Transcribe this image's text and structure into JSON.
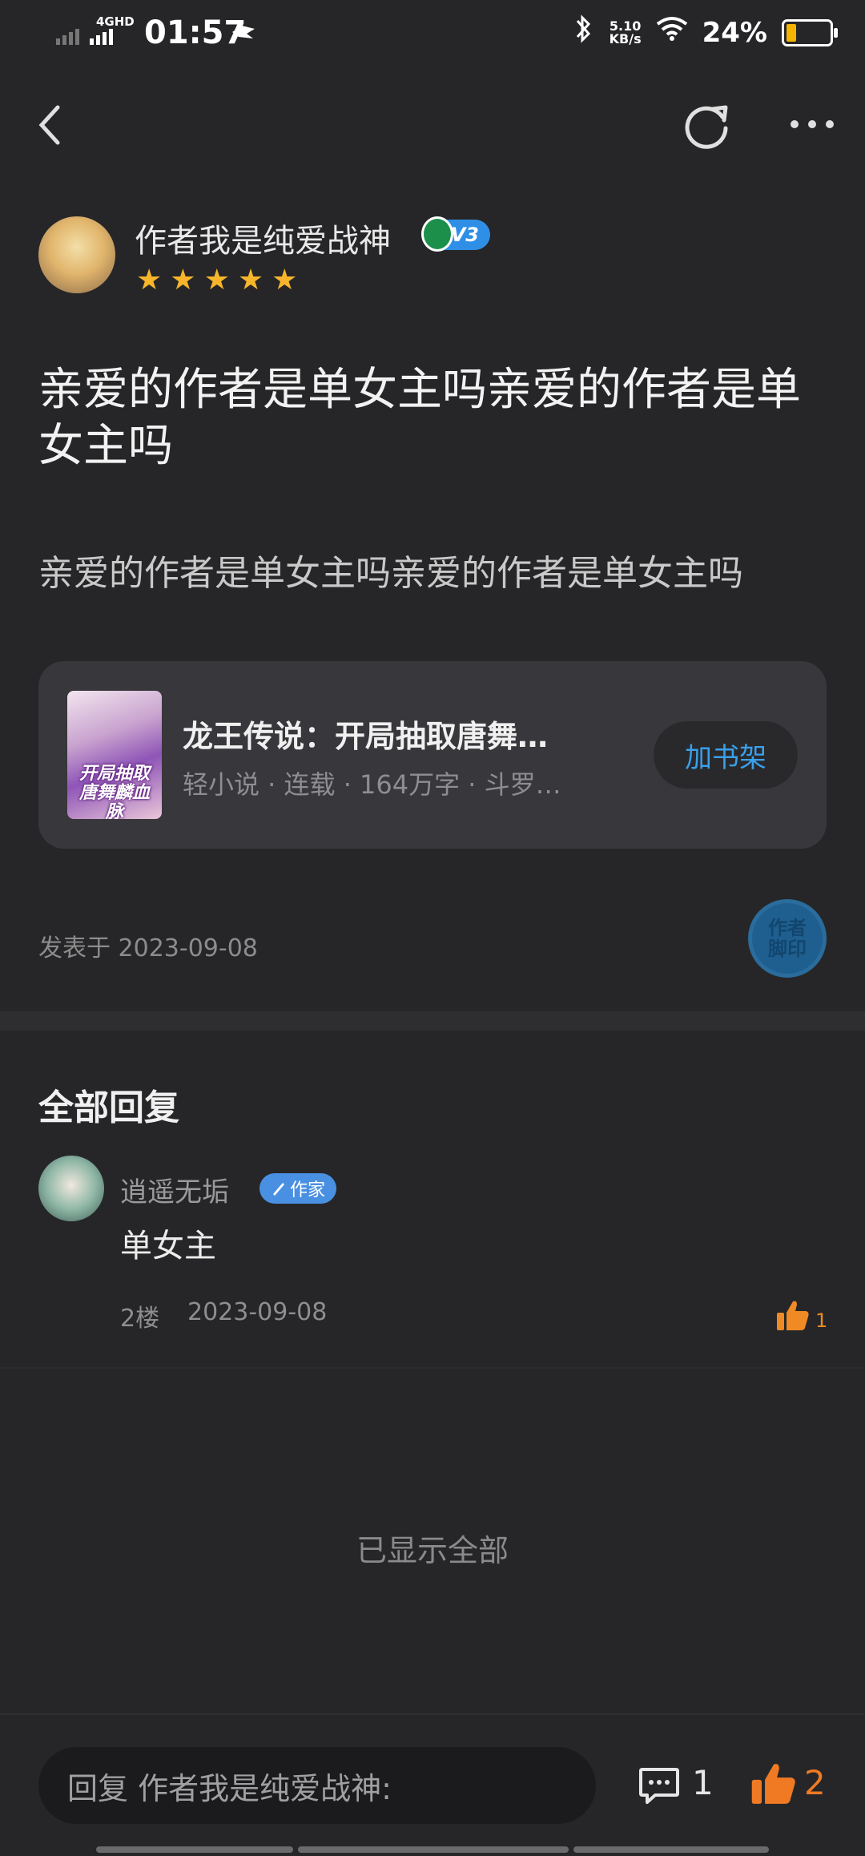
{
  "status_bar": {
    "network": "4GHD",
    "time": "01:57",
    "speed_value": "5.10",
    "speed_unit": "KB/s",
    "battery": "24%"
  },
  "header": {
    "back_icon": "chevron-left-icon",
    "refresh_icon": "refresh-icon",
    "more_icon": "more-horizontal-icon"
  },
  "author": {
    "name": "作者我是纯爱战神",
    "level": "V3",
    "stars": [
      "★",
      "★",
      "★",
      "★",
      "★"
    ]
  },
  "post": {
    "title": "亲爱的作者是单女主吗亲爱的作者是单女主吗",
    "body": "亲爱的作者是单女主吗亲爱的作者是单女主吗",
    "date": "发表于 2023-09-08",
    "stamp": "作者\n脚印"
  },
  "book": {
    "title": "龙王传说：开局抽取唐舞…",
    "meta": "轻小说 · 连载 · 164万字 · 斗罗…",
    "add_button": "加书架",
    "cover_text": "开局抽取唐舞麟血脉"
  },
  "replies": {
    "section_title": "全部回复",
    "items": [
      {
        "name": "逍遥无垢",
        "tag": "作家",
        "text": "单女主",
        "floor": "2楼",
        "date": "2023-09-08",
        "likes": "1"
      }
    ],
    "end_text": "已显示全部"
  },
  "bottom_bar": {
    "input_placeholder": "回复 作者我是纯爱战神:",
    "comment_count": "1",
    "like_count": "2"
  },
  "colors": {
    "background": "#262628",
    "accent_blue": "#3aa0ea",
    "like_orange": "#f07a24",
    "star": "#f7b52c"
  }
}
